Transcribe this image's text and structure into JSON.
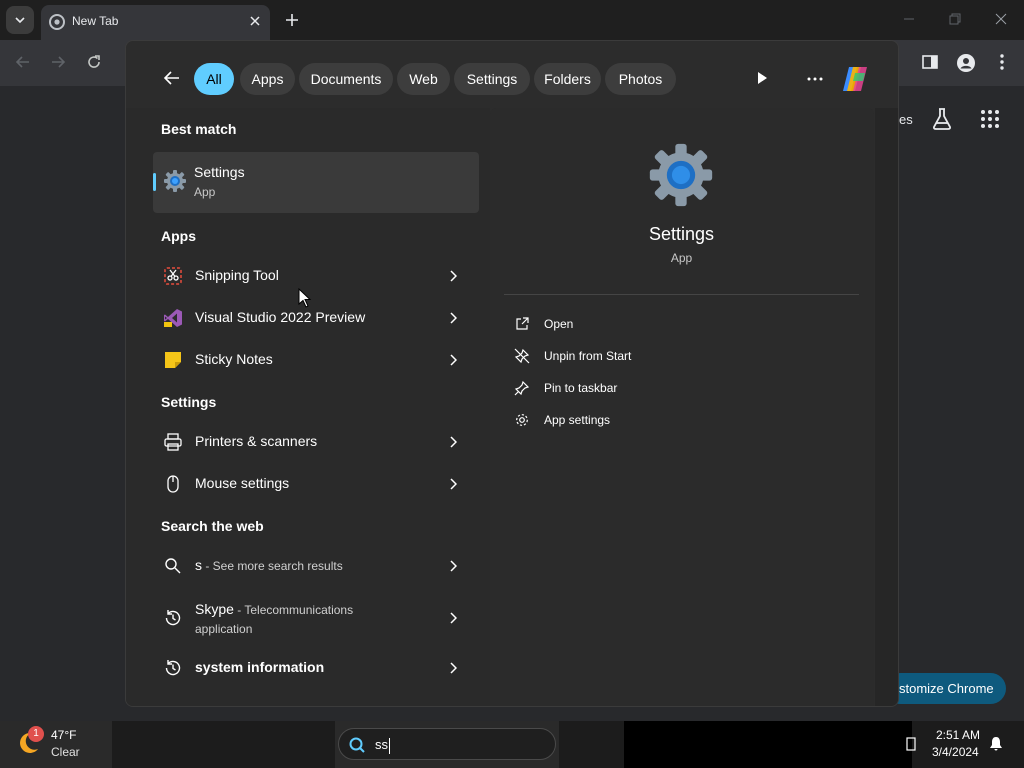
{
  "browser": {
    "tab_title": "New Tab",
    "right_link_partial": "es",
    "customize_partial": "stomize Chrome"
  },
  "search_panel": {
    "filters": [
      {
        "label": "All",
        "active": true
      },
      {
        "label": "Apps"
      },
      {
        "label": "Documents"
      },
      {
        "label": "Web"
      },
      {
        "label": "Settings"
      },
      {
        "label": "Folders"
      },
      {
        "label": "Photos"
      }
    ],
    "best_match": {
      "heading": "Best match",
      "title": "Settings",
      "subtitle": "App",
      "icon": "settings-gear-icon"
    },
    "apps": {
      "heading": "Apps",
      "items": [
        {
          "label": "Snipping Tool",
          "icon": "snipping-tool-icon"
        },
        {
          "label": "Visual Studio 2022 Preview",
          "icon": "visual-studio-icon"
        },
        {
          "label": "Sticky Notes",
          "icon": "sticky-notes-icon"
        }
      ]
    },
    "settings": {
      "heading": "Settings",
      "items": [
        {
          "label": "Printers & scanners",
          "icon": "printer-icon"
        },
        {
          "label": "Mouse settings",
          "icon": "mouse-icon"
        }
      ]
    },
    "web": {
      "heading": "Search the web",
      "items": [
        {
          "label": "s",
          "suffix": " - See more search results",
          "icon": "search-icon"
        },
        {
          "label": "Skype",
          "suffix": " - Telecommunications",
          "suffix2": "application",
          "icon": "history-icon"
        },
        {
          "label": "system information",
          "icon": "history-icon"
        }
      ]
    },
    "preview": {
      "title": "Settings",
      "subtitle": "App",
      "actions": [
        {
          "label": "Open",
          "icon": "open-external-icon"
        },
        {
          "label": "Unpin from Start",
          "icon": "unpin-icon"
        },
        {
          "label": "Pin to taskbar",
          "icon": "pin-icon"
        },
        {
          "label": "App settings",
          "icon": "gear-icon"
        }
      ]
    }
  },
  "taskbar": {
    "weather_temp": "47°F",
    "weather_condition": "Clear",
    "weather_badge": "1",
    "search_value": "ss",
    "time": "2:51 AM",
    "date": "3/4/2024"
  },
  "colors": {
    "accent": "#60cdff",
    "panel": "#2c2c2c",
    "customize_button": "#0e5a7e"
  }
}
